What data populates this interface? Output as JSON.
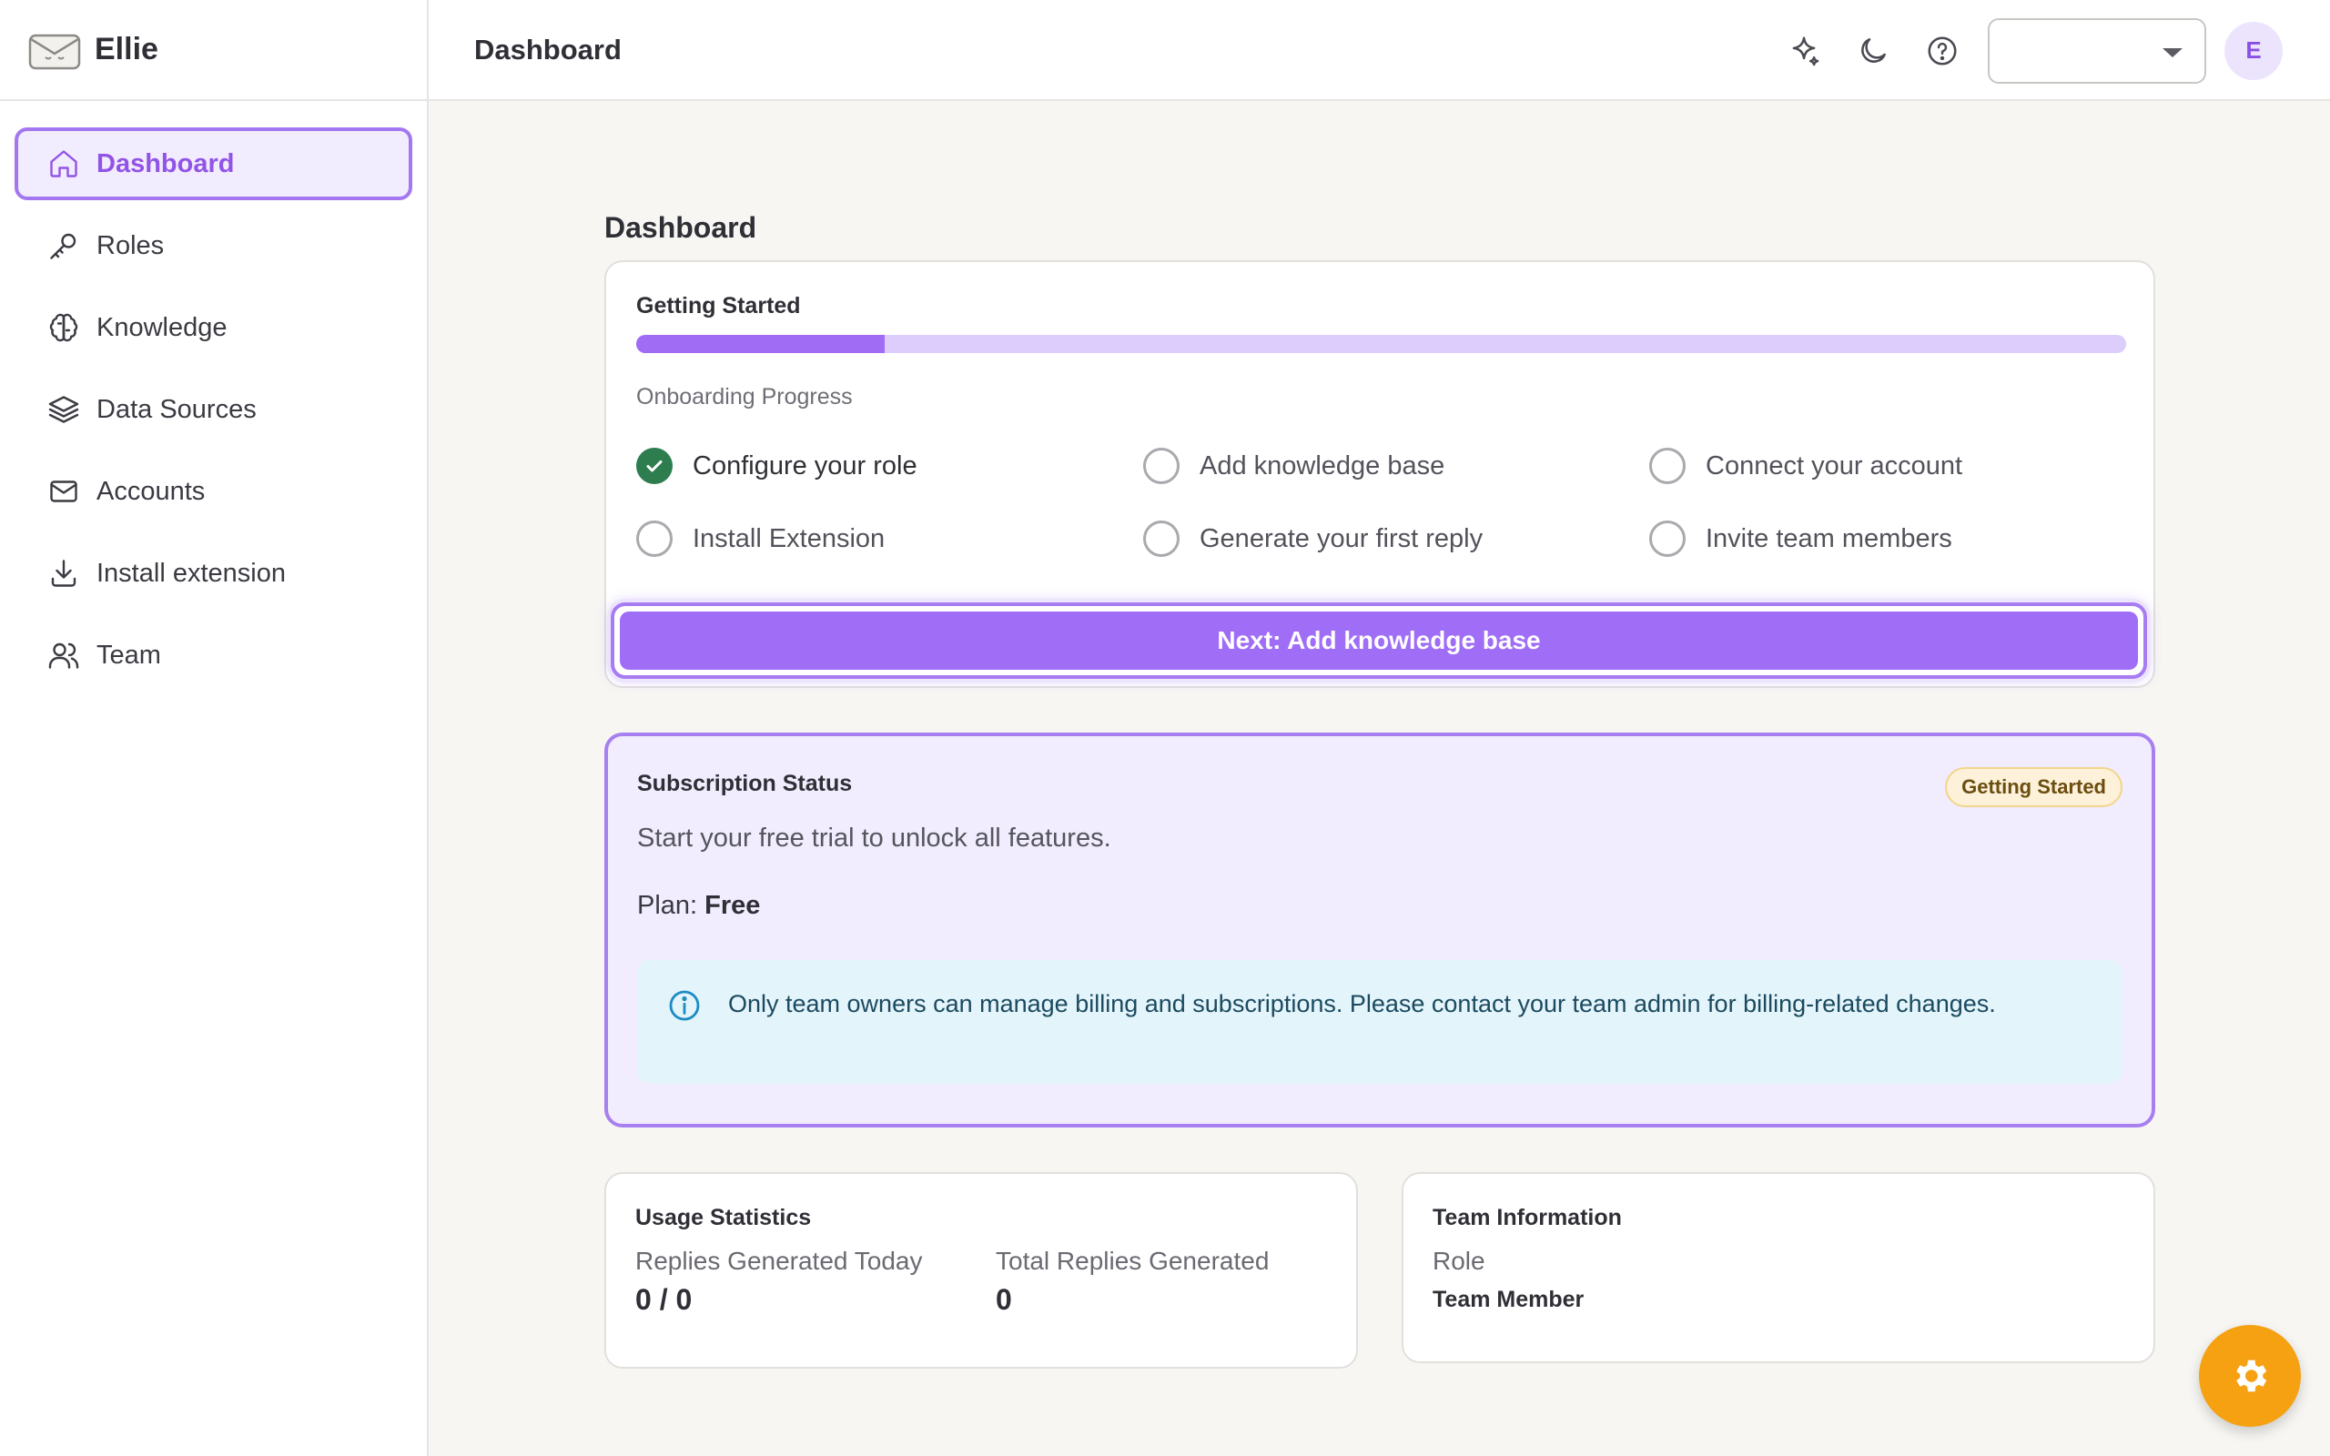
{
  "app": {
    "name": "Ellie"
  },
  "colors": {
    "accent": "#9f6df6",
    "accent_soft": "#f1ecfe",
    "success": "#2e7d4f",
    "badge_bg": "#fdf2d9",
    "fab": "#f5a112",
    "info_bg": "#e3f4fa"
  },
  "sidebar": {
    "items": [
      {
        "label": "Dashboard",
        "icon": "home-icon",
        "active": true
      },
      {
        "label": "Roles",
        "icon": "key-icon",
        "active": false
      },
      {
        "label": "Knowledge",
        "icon": "brain-icon",
        "active": false
      },
      {
        "label": "Data Sources",
        "icon": "layers-icon",
        "active": false
      },
      {
        "label": "Accounts",
        "icon": "mail-icon",
        "active": false
      },
      {
        "label": "Install extension",
        "icon": "download-icon",
        "active": false
      },
      {
        "label": "Team",
        "icon": "users-icon",
        "active": false
      }
    ]
  },
  "header": {
    "title": "Dashboard",
    "icons": [
      "sparkles-icon",
      "moon-icon",
      "help-circle-icon"
    ],
    "select_value": "",
    "avatar_initial": "E"
  },
  "main": {
    "title": "Dashboard",
    "getting_started": {
      "title": "Getting Started",
      "progress_fraction": 0.167,
      "subtitle": "Onboarding Progress",
      "steps": [
        {
          "label": "Configure your role",
          "done": true
        },
        {
          "label": "Add knowledge base",
          "done": false
        },
        {
          "label": "Connect your account",
          "done": false
        },
        {
          "label": "Install Extension",
          "done": false
        },
        {
          "label": "Generate your first reply",
          "done": false
        },
        {
          "label": "Invite team members",
          "done": false
        }
      ],
      "next_button": "Next: Add knowledge base"
    },
    "subscription": {
      "title": "Subscription Status",
      "badge": "Getting Started",
      "description": "Start your free trial to unlock all features.",
      "plan_label": "Plan:",
      "plan_value": "Free",
      "info": "Only team owners can manage billing and subscriptions. Please contact your team admin for billing-related changes."
    },
    "usage": {
      "title": "Usage Statistics",
      "today_label": "Replies Generated Today",
      "today_value": "0 / 0",
      "total_label": "Total Replies Generated",
      "total_value": "0"
    },
    "team": {
      "title": "Team Information",
      "role_label": "Role",
      "role_value": "Team Member"
    }
  },
  "fab": {
    "icon": "settings-icon"
  }
}
